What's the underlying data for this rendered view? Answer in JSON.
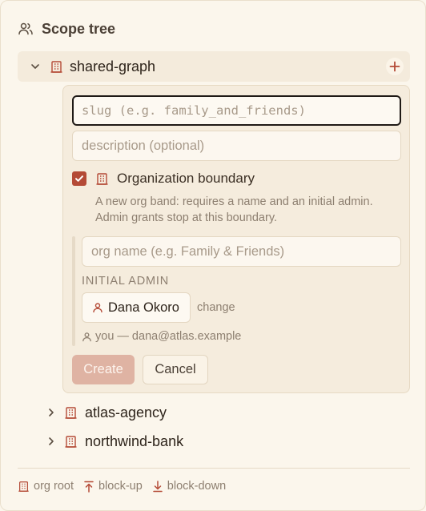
{
  "header": {
    "title": "Scope tree",
    "icon": "users-icon"
  },
  "tree": {
    "root": {
      "label": "shared-graph",
      "expanded": true
    },
    "children": [
      {
        "label": "atlas-agency"
      },
      {
        "label": "northwind-bank"
      }
    ]
  },
  "form": {
    "slug_placeholder": "slug (e.g. family_and_friends)",
    "description_placeholder": "description (optional)",
    "org_boundary_label": "Organization boundary",
    "org_boundary_checked": true,
    "org_hint_1": "A new org band: requires a name and an initial admin.",
    "org_hint_2": "Admin grants stop at this boundary.",
    "org_name_placeholder": "org name (e.g. Family & Friends)",
    "initial_admin_label": "INITIAL ADMIN",
    "admin_name": "Dana Okoro",
    "change_label": "change",
    "you_line": "you — dana@atlas.example",
    "create_label": "Create",
    "cancel_label": "Cancel"
  },
  "legend": {
    "org_root": "org root",
    "block_up": "block-up",
    "block_down": "block-down"
  },
  "colors": {
    "accent": "#b44a36",
    "background": "#fbf6ec",
    "create_disabled": "#dfb3a3"
  }
}
